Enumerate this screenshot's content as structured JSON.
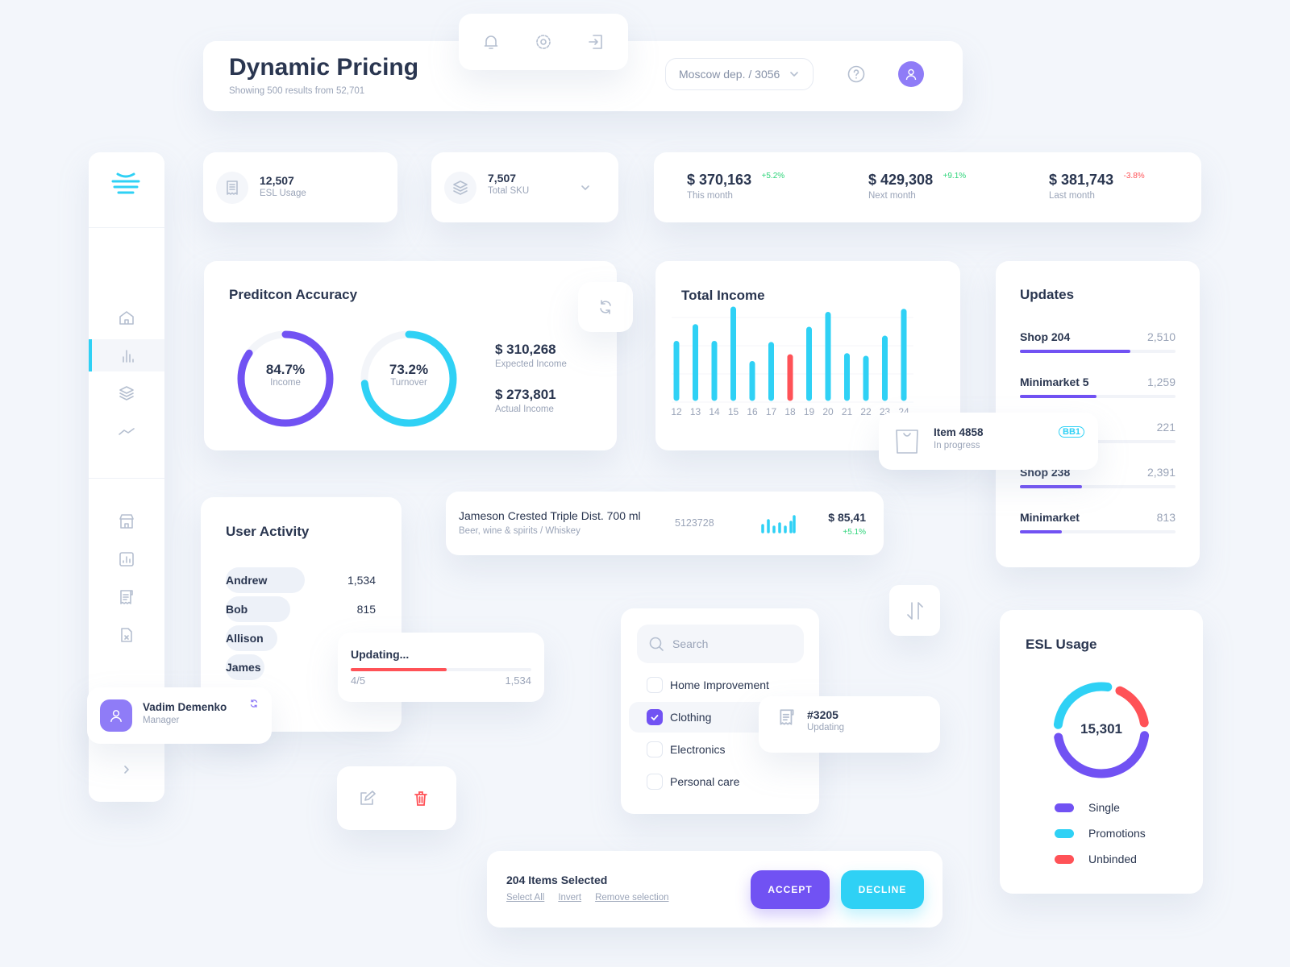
{
  "header": {
    "title": "Dynamic Pricing",
    "subtitle": "Showing 500 results from 52,701",
    "department": "Moscow dep. / 3056",
    "icons": [
      "bell-icon",
      "gear-icon",
      "logout-icon",
      "help-icon",
      "user-icon"
    ]
  },
  "sidebar": {
    "active": "analytics",
    "items": [
      "home",
      "analytics",
      "layers",
      "trend",
      "store",
      "report",
      "receipt",
      "file-x"
    ],
    "user": {
      "name": "Vadim Demenko",
      "role": "Manager"
    }
  },
  "stats": {
    "esl": {
      "value": "12,507",
      "label": "ESL Usage"
    },
    "sku": {
      "value": "7,507",
      "label": "Total SKU"
    },
    "money": [
      {
        "value": "$ 370,163",
        "change": "+5.2%",
        "label": "This month",
        "positive": true
      },
      {
        "value": "$ 429,308",
        "change": "+9.1%",
        "label": "Next month",
        "positive": true
      },
      {
        "value": "$ 381,743",
        "change": "-3.8%",
        "label": "Last month",
        "positive": false
      }
    ]
  },
  "prediction": {
    "title": "Preditcon Accuracy",
    "rings": [
      {
        "value": "84.7%",
        "label": "Income",
        "fraction": 0.847,
        "color": "#7152f3"
      },
      {
        "value": "73.2%",
        "label": "Turnover",
        "fraction": 0.732,
        "color": "#2fd1f5"
      }
    ],
    "expected": {
      "value": "$ 310,268",
      "label": "Expected Income"
    },
    "actual": {
      "value": "$ 273,801",
      "label": "Actual Income"
    }
  },
  "chart_data": {
    "type": "bar",
    "title": "Total Income",
    "categories": [
      "12",
      "13",
      "14",
      "15",
      "16",
      "17",
      "18",
      "19",
      "20",
      "21",
      "22",
      "23",
      "24"
    ],
    "values": [
      146,
      191,
      146,
      238,
      92,
      143,
      110,
      184,
      224,
      113,
      106,
      160,
      232
    ],
    "highlight_index": 6,
    "colors": {
      "bar": "#2fd1f5",
      "highlight": "#ff5257"
    },
    "grid": true
  },
  "updates": {
    "title": "Updates",
    "items": [
      {
        "name": "Shop 204",
        "value": "2,510",
        "fraction": 0.71
      },
      {
        "name": "Minimarket 5",
        "value": "1,259",
        "fraction": 0.49
      },
      {
        "name": "",
        "value": "221",
        "fraction": 0.2
      },
      {
        "name": "Shop 238",
        "value": "2,391",
        "fraction": 0.4
      },
      {
        "name": "Minimarket",
        "value": "813",
        "fraction": 0.27
      }
    ]
  },
  "item_popup": {
    "name": "Item 4858",
    "status": "In progress",
    "badge": "BB1"
  },
  "user_activity": {
    "title": "User Activity",
    "users": [
      {
        "name": "Andrew",
        "value": "1,534"
      },
      {
        "name": "Bob",
        "value": "815"
      },
      {
        "name": "Allison",
        "value": ""
      },
      {
        "name": "James",
        "value": ""
      }
    ]
  },
  "product": {
    "name": "Jameson Crested Triple Dist. 700 ml",
    "category": "Beer, wine & spirits / Whiskey",
    "code": "5123728",
    "price": "$ 85,41",
    "change": "+5.1%"
  },
  "updating": {
    "title": "Updating...",
    "step": "4/5",
    "value": "1,534",
    "progress": 0.53
  },
  "filter": {
    "search_placeholder": "Search",
    "options": [
      {
        "label": "Home Improvement",
        "checked": false
      },
      {
        "label": "Clothing",
        "checked": true
      },
      {
        "label": "Electronics",
        "checked": false
      },
      {
        "label": "Personal care",
        "checked": false
      }
    ]
  },
  "receipt": {
    "id": "#3205",
    "status": "Updating"
  },
  "esl_usage": {
    "title": "ESL Usage",
    "total": "15,301",
    "segments": [
      {
        "name": "Single",
        "share": 0.5,
        "color": "#7152f3"
      },
      {
        "name": "Promotions",
        "share": 0.3,
        "color": "#2fd1f5"
      },
      {
        "name": "Unbinded",
        "share": 0.2,
        "color": "#ff5257"
      }
    ]
  },
  "selection": {
    "count_label": "204 Items Selected",
    "select_all": "Select All",
    "invert": "Invert",
    "remove": "Remove selection",
    "accept": "ACCEPT",
    "decline": "DECLINE"
  }
}
